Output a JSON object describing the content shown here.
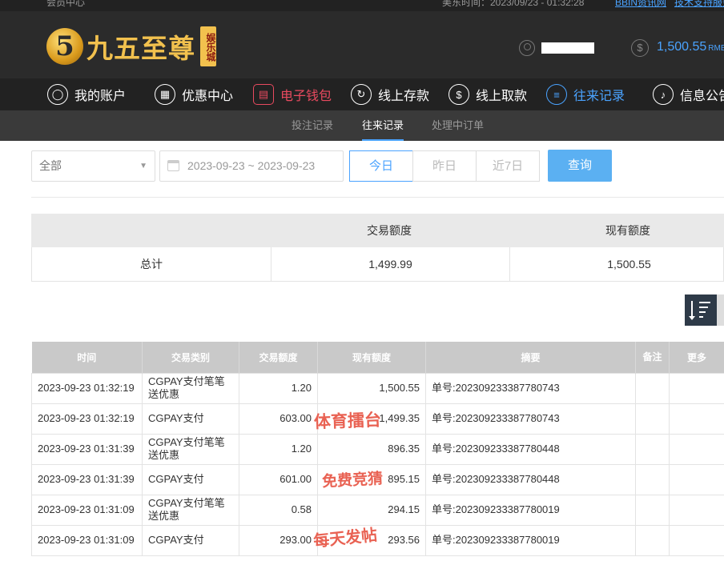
{
  "topbar": {
    "member_center": "会员中心",
    "time_text": "美东时间：2023/09/23 - 01:32:28",
    "link_news": "BBIN资讯网",
    "link_support": "技术支持服务"
  },
  "header": {
    "logo_mark": "5",
    "logo_text": "九五至尊",
    "logo_seal": "娱乐城",
    "balance": "1,500.55",
    "balance_unit": "RMB"
  },
  "nav": [
    {
      "label": "我的账户",
      "icon": "user-icon"
    },
    {
      "label": "优惠中心",
      "icon": "gift-icon"
    },
    {
      "label": "电子钱包",
      "icon": "wallet-icon"
    },
    {
      "label": "线上存款",
      "icon": "deposit-icon"
    },
    {
      "label": "线上取款",
      "icon": "withdraw-icon"
    },
    {
      "label": "往来记录",
      "icon": "records-icon"
    },
    {
      "label": "信息公告",
      "icon": "bell-icon"
    }
  ],
  "subnav": [
    {
      "label": "投注记录"
    },
    {
      "label": "往来记录"
    },
    {
      "label": "处理中订单"
    }
  ],
  "filters": {
    "type_value": "全部",
    "date_range": "2023-09-23 ~ 2023-09-23",
    "today": "今日",
    "yesterday": "昨日",
    "last7": "近7日",
    "search": "查询"
  },
  "summary": {
    "head_amount": "交易额度",
    "head_balance": "现有额度",
    "total_label": "总计",
    "total_amount": "1,499.99",
    "total_balance": "1,500.55"
  },
  "records": {
    "columns": [
      "时间",
      "交易类别",
      "交易额度",
      "现有额度",
      "摘要",
      "备注",
      "更多"
    ],
    "rows": [
      {
        "time": "2023-09-23 01:32:19",
        "type": "CGPAY支付笔笔送优惠",
        "amount": "1.20",
        "balance": "1,500.55",
        "summary": "单号:202309233387780743"
      },
      {
        "time": "2023-09-23 01:32:19",
        "type": "CGPAY支付",
        "amount": "603.00",
        "balance": "1,499.35",
        "summary": "单号:202309233387780743"
      },
      {
        "time": "2023-09-23 01:31:39",
        "type": "CGPAY支付笔笔送优惠",
        "amount": "1.20",
        "balance": "896.35",
        "summary": "单号:202309233387780448"
      },
      {
        "time": "2023-09-23 01:31:39",
        "type": "CGPAY支付",
        "amount": "601.00",
        "balance": "895.15",
        "summary": "单号:202309233387780448"
      },
      {
        "time": "2023-09-23 01:31:09",
        "type": "CGPAY支付笔笔送优惠",
        "amount": "0.58",
        "balance": "294.15",
        "summary": "单号:202309233387780019"
      },
      {
        "time": "2023-09-23 01:31:09",
        "type": "CGPAY支付",
        "amount": "293.00",
        "balance": "293.56",
        "summary": "单号:202309233387780019"
      }
    ]
  },
  "watermarks": [
    "体育擂台",
    "免费竞猜",
    "每天发帖"
  ],
  "colors": {
    "accent_blue": "#4aa3ff",
    "wallet_red": "#e84a5f",
    "watermark_red": "#e85a4a"
  }
}
